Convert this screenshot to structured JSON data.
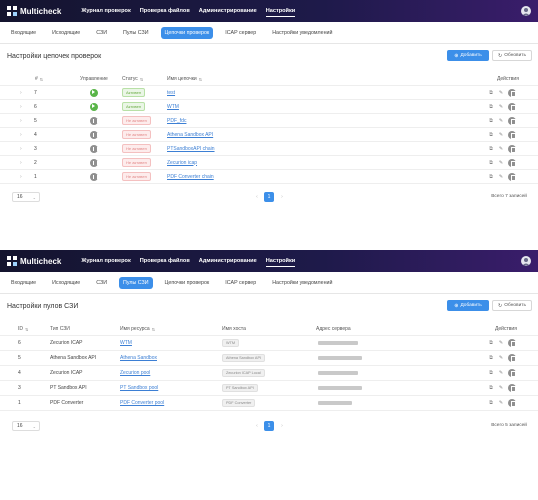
{
  "app": {
    "name": "Multicheck",
    "nav": [
      "Журнал проверок",
      "Проверка файлов",
      "Администрирование",
      "Настройки"
    ],
    "active_nav": "Настройки"
  },
  "screen1": {
    "subnav": [
      "Входящие",
      "Исходящие",
      "СЗИ",
      "Пулы СЗИ",
      "Цепочки проверок",
      "ICAP сервер",
      "Настройки уведомлений"
    ],
    "active_subnav": "Цепочки проверок",
    "title": "Настройки цепочек проверок",
    "add_label": "Добавить",
    "refresh_label": "Обновить",
    "columns": {
      "num": "#",
      "control": "Управление",
      "status": "Статус",
      "name": "Имя цепочки",
      "actions": "Действия"
    },
    "rows": [
      {
        "num": "7",
        "active": true,
        "status": "Активен",
        "name": "test"
      },
      {
        "num": "6",
        "active": true,
        "status": "Активен",
        "name": "WTM"
      },
      {
        "num": "5",
        "active": false,
        "status": "Не активен",
        "name": "PDF_fdc"
      },
      {
        "num": "4",
        "active": false,
        "status": "Не активен",
        "name": "Athena Sandbox API"
      },
      {
        "num": "3",
        "active": false,
        "status": "Не активен",
        "name": "PTSandboxAPI chain"
      },
      {
        "num": "2",
        "active": false,
        "status": "Не активен",
        "name": "Zecurion icap"
      },
      {
        "num": "1",
        "active": false,
        "status": "Не активен",
        "name": "PDF Converter chain"
      }
    ],
    "per_page": "16",
    "current_page": "1",
    "total": "Всего 7 записей"
  },
  "screen2": {
    "subnav": [
      "Входящие",
      "Исходящие",
      "СЗИ",
      "Пулы СЗИ",
      "Цепочки проверок",
      "ICAP сервер",
      "Настройки уведомлений"
    ],
    "active_subnav": "Пулы СЗИ",
    "title": "Настройки пулов СЗИ",
    "add_label": "Добавить",
    "refresh_label": "Обновить",
    "columns": {
      "id": "ID",
      "type": "Тип СЗИ",
      "resource": "Имя ресурса",
      "host": "Имя хоста",
      "address": "Адрес сервера",
      "actions": "Действия"
    },
    "rows": [
      {
        "id": "6",
        "type": "Zecurion ICAP",
        "resource": "WTM",
        "host": "WTM"
      },
      {
        "id": "5",
        "type": "Athena Sandbox API",
        "resource": "Athena Sandbox",
        "host": "Athena Sandbox API"
      },
      {
        "id": "4",
        "type": "Zecurion ICAP",
        "resource": "Zecurion pool",
        "host": "Zecurion ICAP Local"
      },
      {
        "id": "3",
        "type": "PT Sandbox API",
        "resource": "PT Sandbox pool",
        "host": "PT Sandbox API"
      },
      {
        "id": "1",
        "type": "PDF Converter",
        "resource": "PDF Converter pool",
        "host": "PDF Converter"
      }
    ],
    "per_page": "16",
    "current_page": "1",
    "total": "Всего 5 записей"
  }
}
